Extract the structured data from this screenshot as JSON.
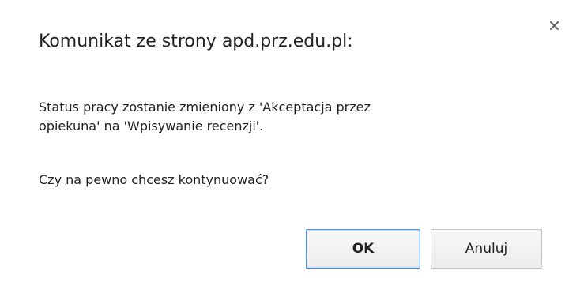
{
  "dialog": {
    "title": "Komunikat ze strony apd.prz.edu.pl:",
    "message_line1": "Status pracy zostanie zmieniony z 'Akceptacja przez",
    "message_line2": "opiekuna' na 'Wpisywanie recenzji'.",
    "question": "Czy na pewno chcesz kontynuować?",
    "close_icon": "close-icon",
    "ok_label": "OK",
    "cancel_label": "Anuluj"
  },
  "colors": {
    "ok_border": "#4d90fe",
    "text": "#222222",
    "background": "#ffffff"
  }
}
